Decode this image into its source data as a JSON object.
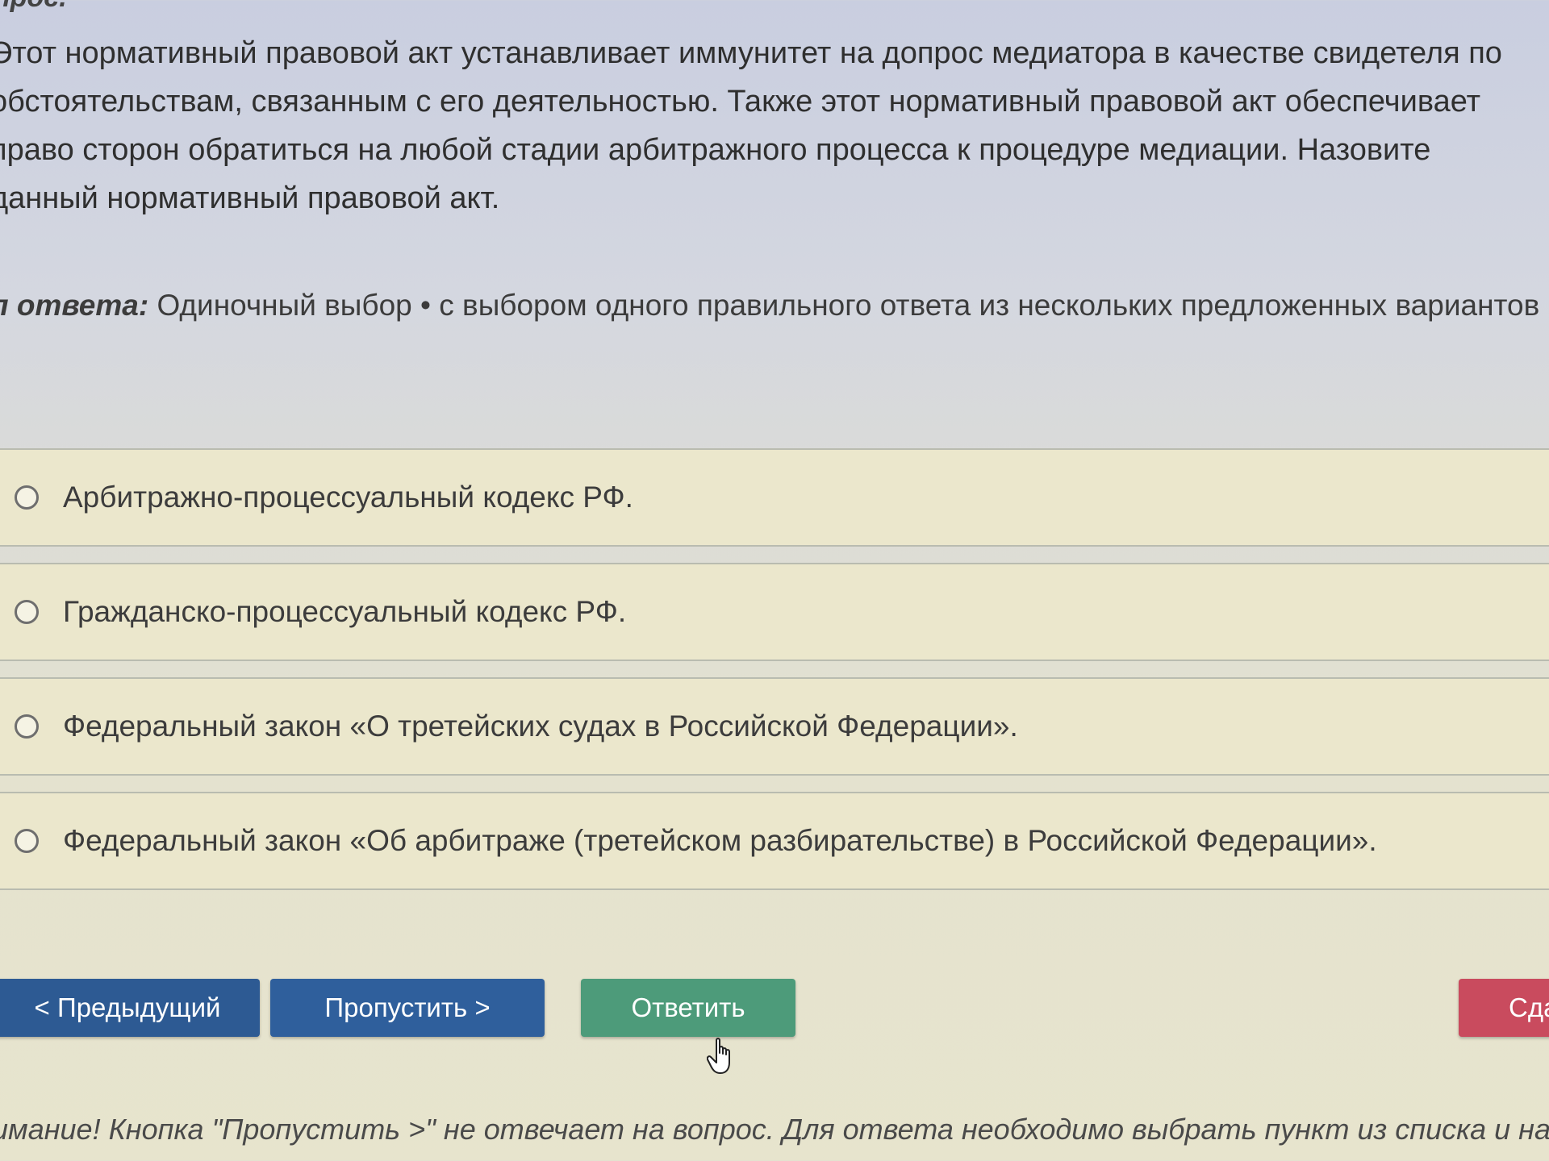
{
  "question": {
    "heading": "прос.",
    "text": "Этот нормативный правовой акт устанавливает иммунитет на допрос медиатора в качестве свидетеля по обстоятельствам, связанным с его деятельностью. Также этот нормативный правовой акт обеспечивает право сторон обратиться на любой стадии арбитражного процесса к процедуре медиации. Назовите данный нормативный правовой акт."
  },
  "answer_type": {
    "label": "п ответа:",
    "value": "Одиночный выбор • с выбором одного правильного ответа из нескольких предложенных вариантов"
  },
  "options": [
    {
      "label": "Арбитражно-процессуальный кодекс РФ."
    },
    {
      "label": "Гражданско-процессуальный кодекс РФ."
    },
    {
      "label": "Федеральный закон «О третейских судах в Российской Федерации»."
    },
    {
      "label": "Федеральный закон «Об арбитраже (третейском разбирательстве) в Российской Федерации»."
    }
  ],
  "buttons": {
    "prev_label": "< Предыдущий",
    "skip_label": "Пропустить >",
    "answer_label": "Ответить",
    "finish_label": "Сда"
  },
  "notice": "имание! Кнопка \"Пропустить >\" не отвечает на вопрос. Для ответа необходимо выбрать пункт из списка и на",
  "colors": {
    "prev_button": "#2d5a93",
    "skip_button": "#2f5f9c",
    "answer_button": "#4d9b7a",
    "finish_button": "#c94b5e",
    "option_background": "#ebe7cc"
  },
  "icons": {
    "cursor": "hand-pointer-icon",
    "radio": "radio-circle-icon"
  }
}
